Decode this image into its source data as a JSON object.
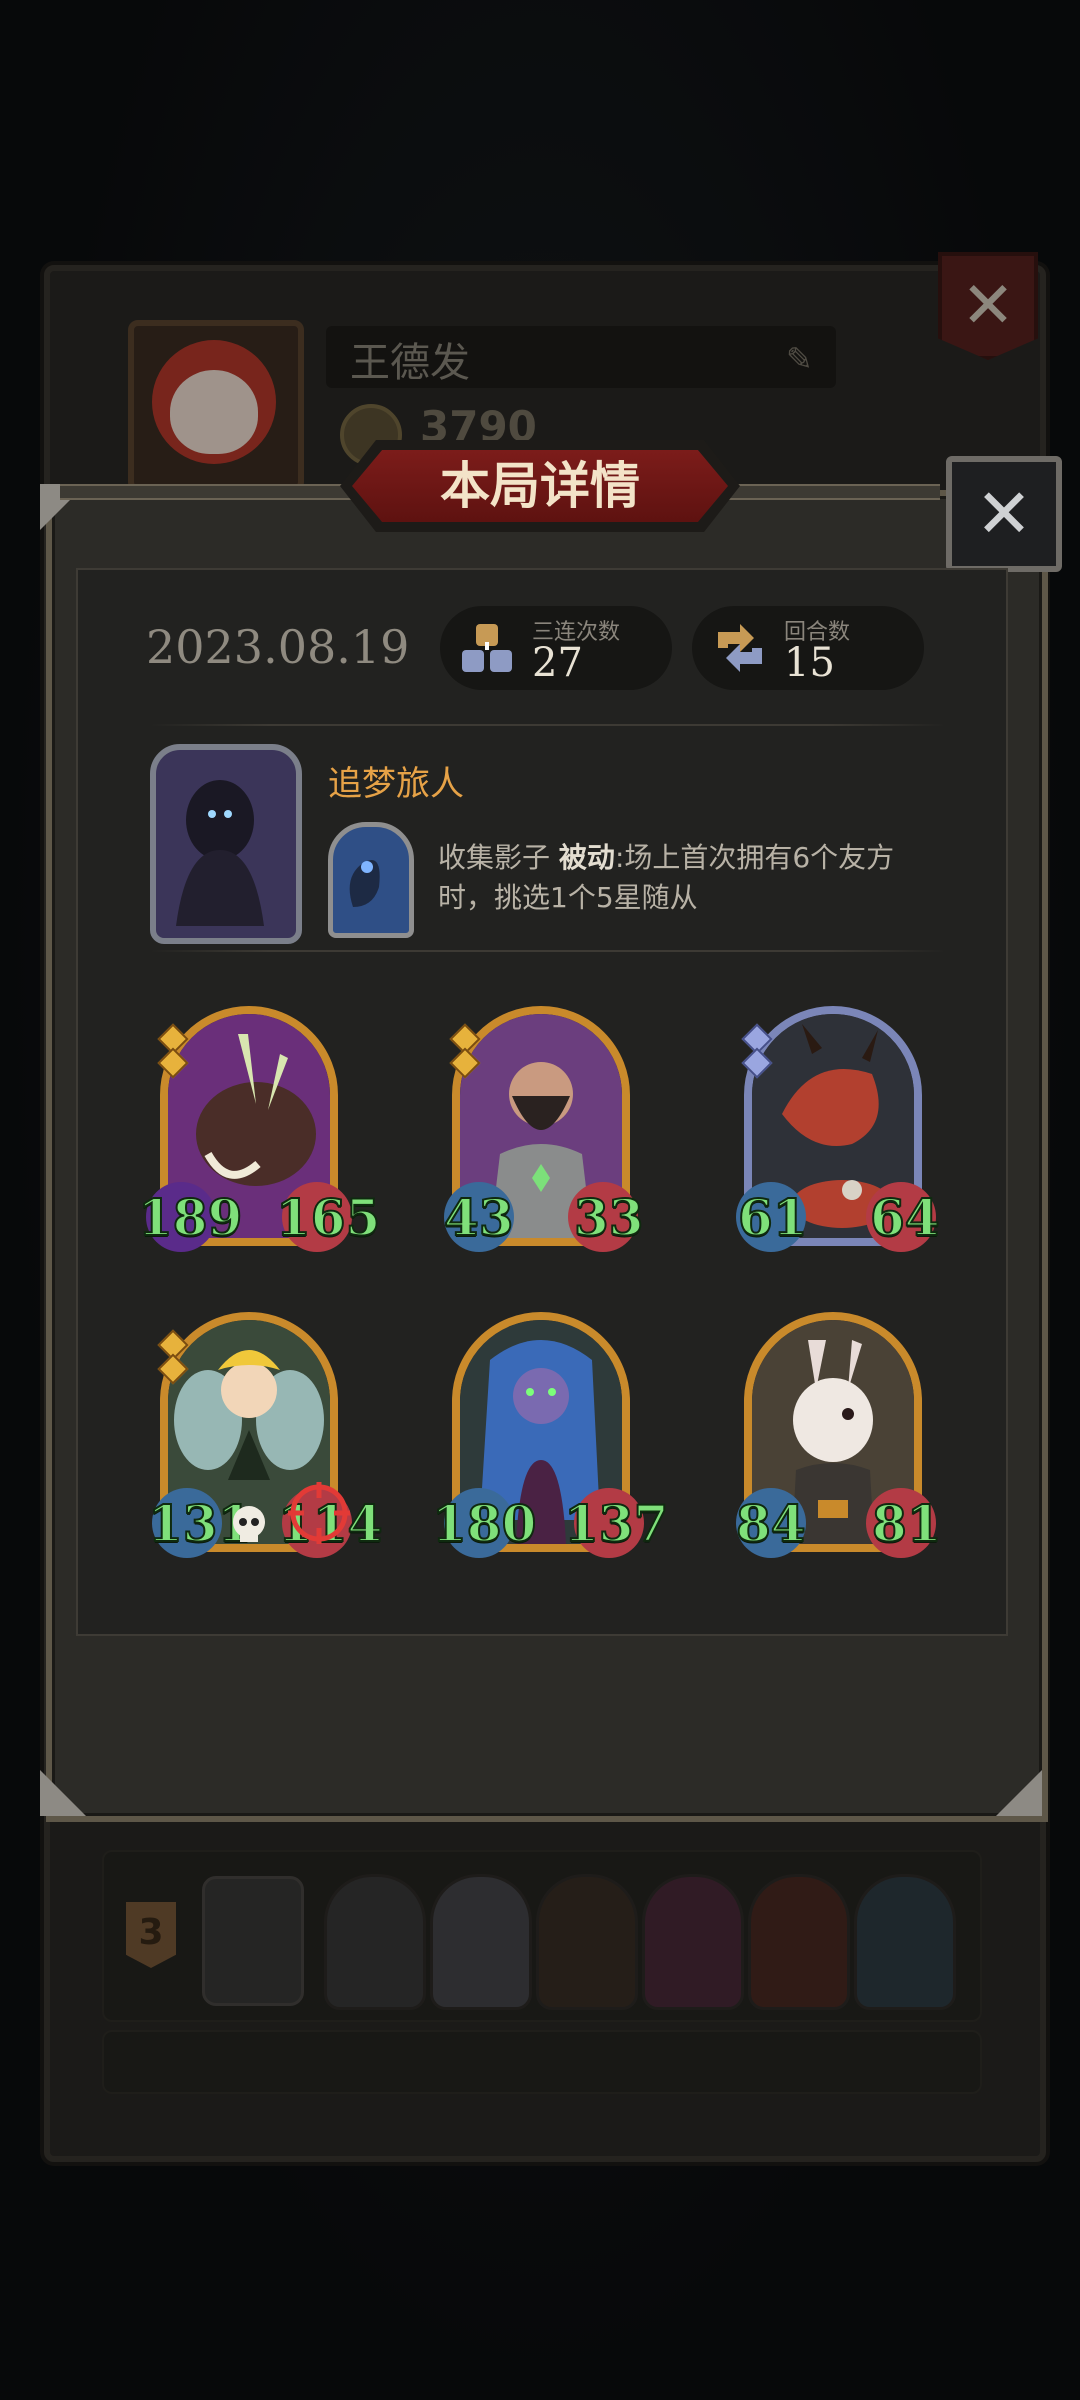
{
  "player": {
    "name": "王德发",
    "coins": "3790"
  },
  "modal": {
    "title": "本局详情",
    "date": "2023.08.19",
    "stats": [
      {
        "label": "三连次数",
        "value": "27",
        "icon": "triple-blocks-icon"
      },
      {
        "label": "回合数",
        "value": "15",
        "icon": "round-arrows-icon"
      }
    ],
    "hero": {
      "name": "追梦旅人",
      "skill_name": "收集影子",
      "skill_type": "被动",
      "skill_text": ":场上首次拥有6个友方时，挑选1个5星随从"
    },
    "units": [
      {
        "atk": "189",
        "hp": "165",
        "frame": "gold",
        "stars": 2,
        "art": "boar"
      },
      {
        "atk": "43",
        "hp": "33",
        "frame": "gold",
        "stars": 2,
        "art": "bearded-warrior"
      },
      {
        "atk": "61",
        "hp": "64",
        "frame": "blue",
        "stars": 2,
        "art": "red-dragon"
      },
      {
        "atk": "131",
        "hp": "114",
        "frame": "gold",
        "stars": 2,
        "art": "fairy"
      },
      {
        "atk": "180",
        "hp": "137",
        "frame": "gold",
        "stars": 0,
        "art": "night-elf"
      },
      {
        "atk": "84",
        "hp": "81",
        "frame": "gold",
        "stars": 0,
        "art": "masked-rabbit"
      }
    ]
  },
  "history": {
    "rows": [
      {
        "rank": "3"
      },
      {
        "rank": ""
      }
    ]
  },
  "colors": {
    "title_red": "#7c1c1a",
    "hero_name": "#e6a247",
    "stat_green": "#7fe07a",
    "gold_frame": "#c98a2b",
    "blue_frame": "#7b86b8"
  }
}
